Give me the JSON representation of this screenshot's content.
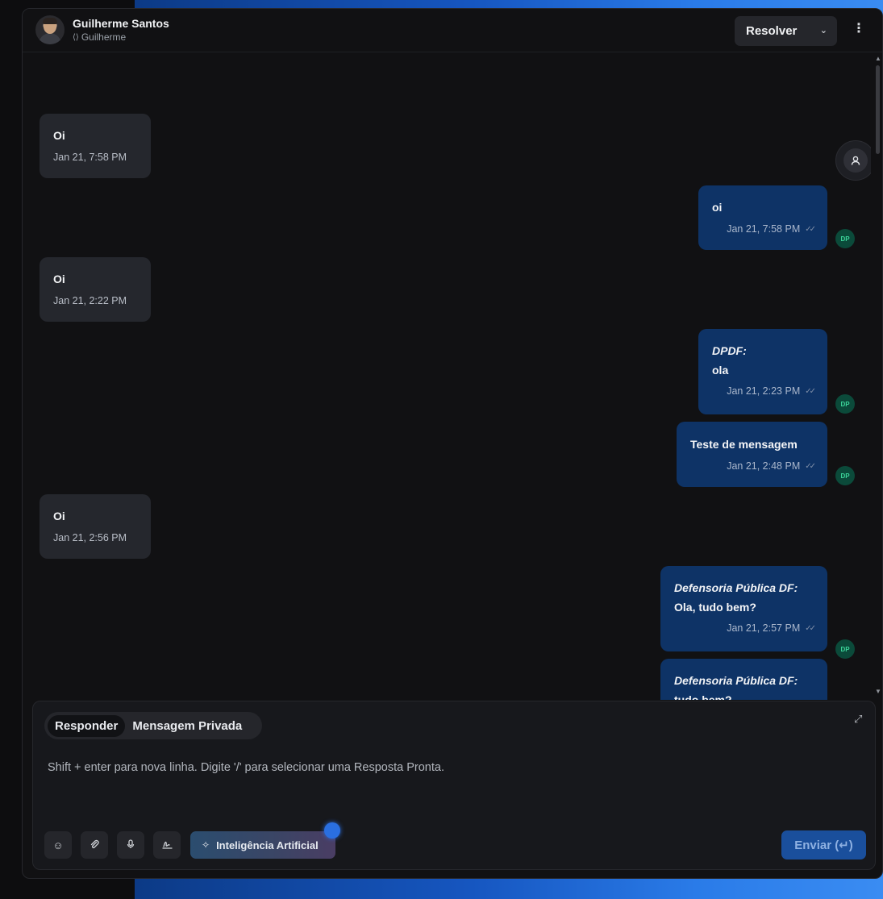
{
  "contact": {
    "name": "Guilherme Santos",
    "handle_icon": "code-icon",
    "handle": "Guilherme"
  },
  "header": {
    "resolve_label": "Resolver",
    "more_icon": "kebab-icon"
  },
  "agent_initials": "DP",
  "messages": [
    {
      "dir": "in",
      "text": "Oi",
      "time": "Jan 21, 7:58 PM"
    },
    {
      "dir": "out",
      "text": "oi",
      "time": "Jan 21, 7:58 PM"
    },
    {
      "dir": "in",
      "text": "Oi",
      "time": "Jan 21, 2:22 PM"
    },
    {
      "dir": "out",
      "prefix": "DPDF:",
      "text": "ola",
      "time": "Jan 21, 2:23 PM"
    },
    {
      "dir": "out",
      "text": "Teste de mensagem",
      "time": "Jan 21, 2:48 PM"
    },
    {
      "dir": "in",
      "text": "Oi",
      "time": "Jan 21, 2:56 PM"
    },
    {
      "dir": "out",
      "prefix": "Defensoria Pública DF:",
      "text": "Ola, tudo bem?",
      "time": "Jan 21, 2:57 PM"
    },
    {
      "dir": "out",
      "prefix": "Defensoria Pública DF:",
      "text": "tudo bem?",
      "time": ""
    }
  ],
  "composer": {
    "tab_reply": "Responder",
    "tab_private": "Mensagem Privada",
    "placeholder": "Shift + enter para nova linha. Digite '/' para selecionar uma Resposta Pronta.",
    "ai_label": "Inteligência Artificial",
    "send_label": "Enviar (↵)"
  }
}
